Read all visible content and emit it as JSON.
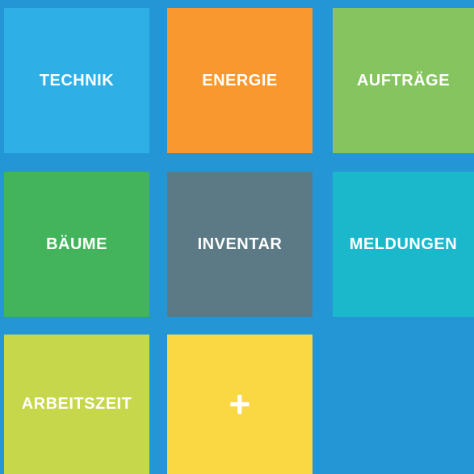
{
  "app": {
    "background_color": "#2496d5"
  },
  "tiles": [
    {
      "label": "TECHNIK",
      "color": "#2eb0e6"
    },
    {
      "label": "ENERGIE",
      "color": "#f8982e"
    },
    {
      "label": "AUFTRÄGE",
      "color": "#85c45e"
    },
    {
      "label": "BÄUME",
      "color": "#43b45b"
    },
    {
      "label": "INVENTAR",
      "color": "#5c7a86"
    },
    {
      "label": "MELDUNGEN",
      "color": "#1bb8cc"
    },
    {
      "label": "ARBEITSZEIT",
      "color": "#c6d74c"
    },
    {
      "label": "+",
      "color": "#f9d844",
      "icon": "plus-icon"
    }
  ]
}
